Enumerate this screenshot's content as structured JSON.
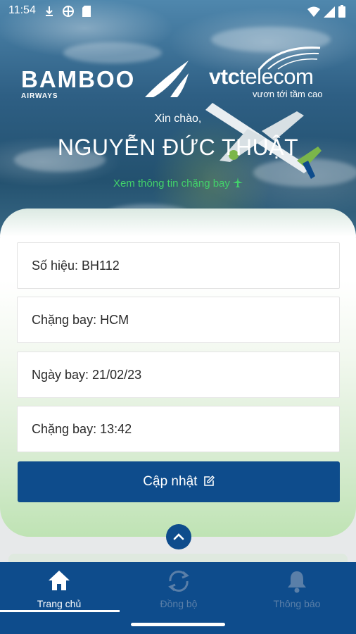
{
  "status_bar": {
    "time": "11:54",
    "battery": "full"
  },
  "brand": {
    "airline_name": "BAMBOO",
    "airline_sub": "AIRWAYS",
    "telecom_vtc": "vtc",
    "telecom_rest": "telecom",
    "telecom_slogan": "vươn tới tầm cao"
  },
  "greeting": "Xin chào,",
  "user_name": "NGUYỄN ĐỨC THUẬT",
  "flight_link": "Xem thông tin chặng bay",
  "fields": [
    {
      "label": "Số hiệu: BH112"
    },
    {
      "label": "Chặng bay: HCM"
    },
    {
      "label": "Ngày bay: 21/02/23"
    },
    {
      "label": "Chặng bay: 13:42"
    }
  ],
  "update_button": "Cập nhật",
  "bottom_nav": [
    {
      "label": "Trang chủ",
      "icon": "home-icon",
      "active": true
    },
    {
      "label": "Đồng bộ",
      "icon": "sync-icon",
      "active": false
    },
    {
      "label": "Thông báo",
      "icon": "bell-icon",
      "active": false
    }
  ],
  "colors": {
    "primary": "#0e4c8c",
    "link_green": "#42d26a",
    "card_green": "#bfe3b4"
  }
}
